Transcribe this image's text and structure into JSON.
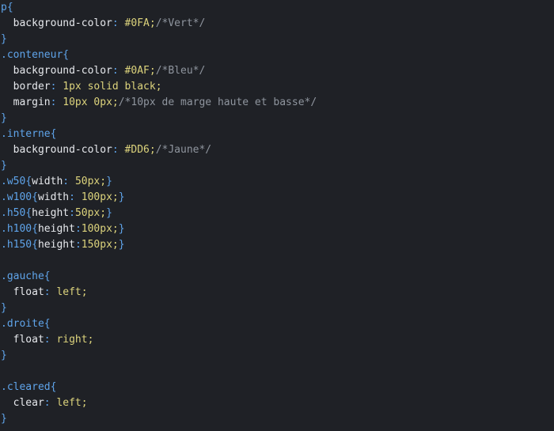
{
  "editor": {
    "language": "css",
    "colors": {
      "background": "#1f2126",
      "selector": "#5fa4ea",
      "property": "#e6e8ec",
      "value": "#dcd37c",
      "comment": "#8f959e"
    },
    "lines": [
      [
        {
          "t": "sel",
          "v": "p"
        },
        {
          "t": "brace",
          "v": "{"
        }
      ],
      [
        {
          "t": "ws",
          "v": "  "
        },
        {
          "t": "prop",
          "v": "background-color"
        },
        {
          "t": "colon",
          "v": ": "
        },
        {
          "t": "val",
          "v": "#0FA"
        },
        {
          "t": "punc",
          "v": ";"
        },
        {
          "t": "comment",
          "v": "/*Vert*/"
        }
      ],
      [
        {
          "t": "brace",
          "v": "}"
        }
      ],
      [
        {
          "t": "sel",
          "v": ".conteneur"
        },
        {
          "t": "brace",
          "v": "{"
        }
      ],
      [
        {
          "t": "ws",
          "v": "  "
        },
        {
          "t": "prop",
          "v": "background-color"
        },
        {
          "t": "colon",
          "v": ": "
        },
        {
          "t": "val",
          "v": "#0AF"
        },
        {
          "t": "punc",
          "v": ";"
        },
        {
          "t": "comment",
          "v": "/*Bleu*/"
        }
      ],
      [
        {
          "t": "ws",
          "v": "  "
        },
        {
          "t": "prop",
          "v": "border"
        },
        {
          "t": "colon",
          "v": ": "
        },
        {
          "t": "val",
          "v": "1px solid black"
        },
        {
          "t": "punc",
          "v": ";"
        }
      ],
      [
        {
          "t": "ws",
          "v": "  "
        },
        {
          "t": "prop",
          "v": "margin"
        },
        {
          "t": "colon",
          "v": ": "
        },
        {
          "t": "val",
          "v": "10px 0px"
        },
        {
          "t": "punc",
          "v": ";"
        },
        {
          "t": "comment",
          "v": "/*10px de marge haute et basse*/"
        }
      ],
      [
        {
          "t": "brace",
          "v": "}"
        }
      ],
      [
        {
          "t": "sel",
          "v": ".interne"
        },
        {
          "t": "brace",
          "v": "{"
        }
      ],
      [
        {
          "t": "ws",
          "v": "  "
        },
        {
          "t": "prop",
          "v": "background-color"
        },
        {
          "t": "colon",
          "v": ": "
        },
        {
          "t": "val",
          "v": "#DD6"
        },
        {
          "t": "punc",
          "v": ";"
        },
        {
          "t": "comment",
          "v": "/*Jaune*/"
        }
      ],
      [
        {
          "t": "brace",
          "v": "}"
        }
      ],
      [
        {
          "t": "sel",
          "v": ".w50"
        },
        {
          "t": "brace",
          "v": "{"
        },
        {
          "t": "prop",
          "v": "width"
        },
        {
          "t": "colon",
          "v": ": "
        },
        {
          "t": "val",
          "v": "50px"
        },
        {
          "t": "punc",
          "v": ";"
        },
        {
          "t": "brace",
          "v": "}"
        }
      ],
      [
        {
          "t": "sel",
          "v": ".w100"
        },
        {
          "t": "brace",
          "v": "{"
        },
        {
          "t": "prop",
          "v": "width"
        },
        {
          "t": "colon",
          "v": ": "
        },
        {
          "t": "val",
          "v": "100px"
        },
        {
          "t": "punc",
          "v": ";"
        },
        {
          "t": "brace",
          "v": "}"
        }
      ],
      [
        {
          "t": "sel",
          "v": ".h50"
        },
        {
          "t": "brace",
          "v": "{"
        },
        {
          "t": "prop",
          "v": "height"
        },
        {
          "t": "colon",
          "v": ":"
        },
        {
          "t": "val",
          "v": "50px"
        },
        {
          "t": "punc",
          "v": ";"
        },
        {
          "t": "brace",
          "v": "}"
        }
      ],
      [
        {
          "t": "sel",
          "v": ".h100"
        },
        {
          "t": "brace",
          "v": "{"
        },
        {
          "t": "prop",
          "v": "height"
        },
        {
          "t": "colon",
          "v": ":"
        },
        {
          "t": "val",
          "v": "100px"
        },
        {
          "t": "punc",
          "v": ";"
        },
        {
          "t": "brace",
          "v": "}"
        }
      ],
      [
        {
          "t": "sel",
          "v": ".h150"
        },
        {
          "t": "brace",
          "v": "{"
        },
        {
          "t": "prop",
          "v": "height"
        },
        {
          "t": "colon",
          "v": ":"
        },
        {
          "t": "val",
          "v": "150px"
        },
        {
          "t": "punc",
          "v": ";"
        },
        {
          "t": "brace",
          "v": "}"
        }
      ],
      [],
      [
        {
          "t": "sel",
          "v": ".gauche"
        },
        {
          "t": "brace",
          "v": "{"
        }
      ],
      [
        {
          "t": "ws",
          "v": "  "
        },
        {
          "t": "prop",
          "v": "float"
        },
        {
          "t": "colon",
          "v": ": "
        },
        {
          "t": "val",
          "v": "left"
        },
        {
          "t": "punc",
          "v": ";"
        }
      ],
      [
        {
          "t": "brace",
          "v": "}"
        }
      ],
      [
        {
          "t": "sel",
          "v": ".droite"
        },
        {
          "t": "brace",
          "v": "{"
        }
      ],
      [
        {
          "t": "ws",
          "v": "  "
        },
        {
          "t": "prop",
          "v": "float"
        },
        {
          "t": "colon",
          "v": ": "
        },
        {
          "t": "val",
          "v": "right"
        },
        {
          "t": "punc",
          "v": ";"
        }
      ],
      [
        {
          "t": "brace",
          "v": "}"
        }
      ],
      [],
      [
        {
          "t": "sel",
          "v": ".cleared"
        },
        {
          "t": "brace",
          "v": "{"
        }
      ],
      [
        {
          "t": "ws",
          "v": "  "
        },
        {
          "t": "prop",
          "v": "clear"
        },
        {
          "t": "colon",
          "v": ": "
        },
        {
          "t": "val",
          "v": "left"
        },
        {
          "t": "punc",
          "v": ";"
        }
      ],
      [
        {
          "t": "brace",
          "v": "}"
        }
      ]
    ]
  }
}
